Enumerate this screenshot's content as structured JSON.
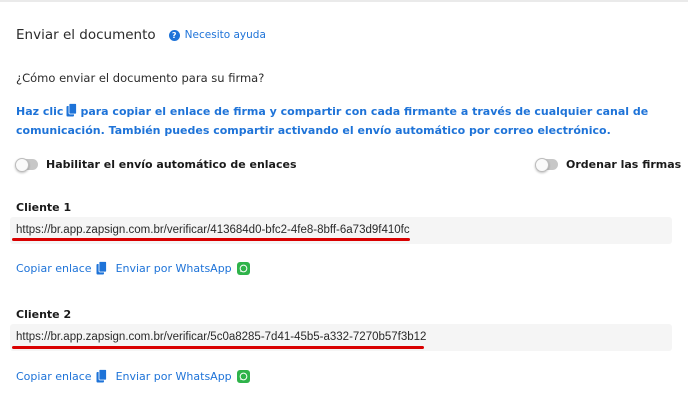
{
  "header": {
    "title": "Enviar el documento",
    "help_label": "Necesito ayuda"
  },
  "question": "¿Cómo enviar el documento para su firma?",
  "info": {
    "part1": "Haz clic",
    "part2": "para copiar el enlace de firma y compartir con cada firmante a través de cualquier canal de comunicación. También puedes compartir activando el envío automático por correo electrónico."
  },
  "toggles": {
    "auto_send_label": "Habilitar el envío automático de enlaces",
    "auto_send_on": false,
    "order_label": "Ordenar las firmas",
    "order_on": false
  },
  "clients": [
    {
      "label": "Cliente 1",
      "url": "https://br.app.zapsign.com.br/verificar/413684d0-bfc2-4fe8-8bff-6a73d9f410fc",
      "copy_label": "Copiar enlace",
      "whatsapp_label": "Enviar por WhatsApp"
    },
    {
      "label": "Cliente 2",
      "url": "https://br.app.zapsign.com.br/verificar/5c0a8285-7d41-45b5-a332-7270b57f3b12",
      "copy_label": "Copiar enlace",
      "whatsapp_label": "Enviar por WhatsApp"
    }
  ],
  "colors": {
    "accent": "#1e73d8",
    "annotation": "#d90000",
    "whatsapp": "#2fb34a"
  }
}
